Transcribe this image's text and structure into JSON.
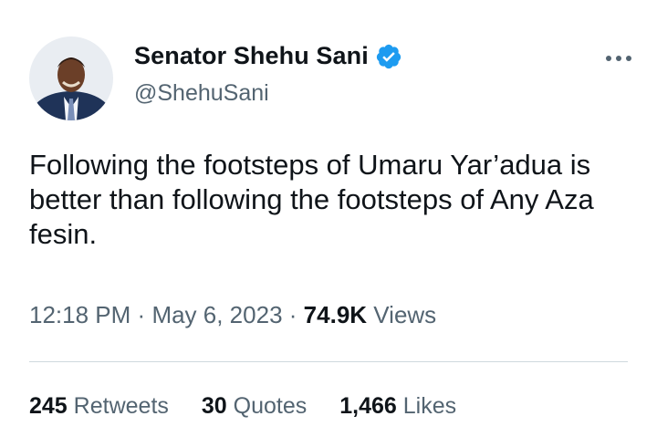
{
  "author": {
    "display_name": "Senator Shehu Sani",
    "handle": "@ShehuSani",
    "verified": true,
    "verified_color": "#1d9bf0"
  },
  "tweet": {
    "text": "Following the footsteps of Umaru Yar’adua is better than following the footsteps of Any Aza fesin."
  },
  "meta": {
    "time": "12:18 PM",
    "separator": "·",
    "date": "May 6, 2023",
    "views_count": "74.9K",
    "views_label": "Views"
  },
  "stats": [
    {
      "count": "245",
      "label": "Retweets"
    },
    {
      "count": "30",
      "label": "Quotes"
    },
    {
      "count": "1,466",
      "label": "Likes"
    }
  ],
  "icons": {
    "more": "more-horizontal-icon",
    "verified": "verified-badge-icon"
  }
}
